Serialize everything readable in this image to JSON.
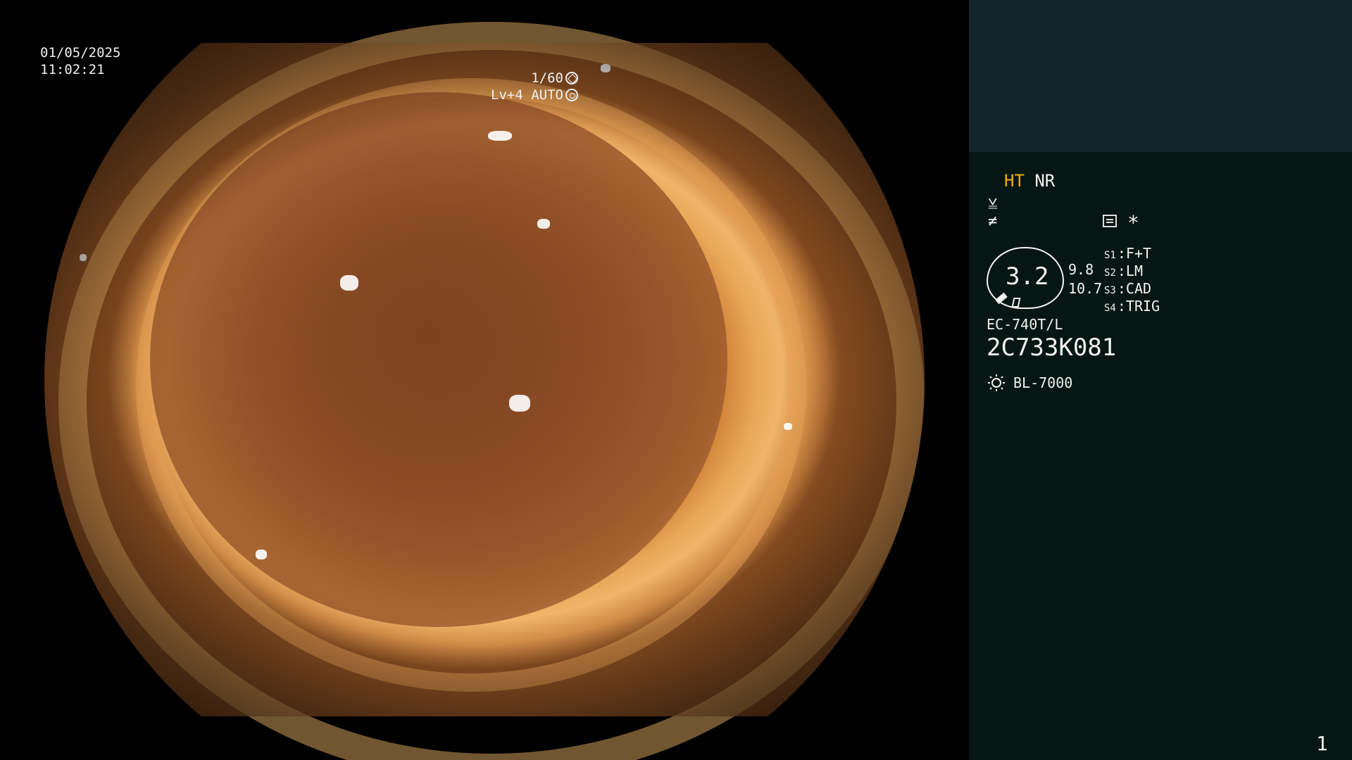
{
  "overlay": {
    "date": "01/05/2025",
    "time": "11:02:21",
    "shutter": "1/60",
    "level": "Lv+4 AUTO"
  },
  "icons": {
    "shutter": "shutter-icon",
    "auto": "auto-exposure-icon",
    "enhance": "enhance-icon",
    "contrast": "contrast-icon",
    "memo": "memo-icon",
    "lamp": "lamp-icon"
  },
  "panel": {
    "mode_ht": "HT",
    "mode_nr": "NR",
    "star": "*",
    "dial_value": "3.2",
    "dial_sub1": "9.8",
    "dial_sub2": "10.7",
    "slots": [
      {
        "key": "S1",
        "value": "F+T"
      },
      {
        "key": "S2",
        "value": "LM"
      },
      {
        "key": "S3",
        "value": "CAD"
      },
      {
        "key": "S4",
        "value": "TRIG"
      }
    ],
    "scope_model": "EC-740T/L",
    "serial": "2C733K081",
    "lamp": "BL-7000",
    "page": "1"
  },
  "colors": {
    "panel_bg": "#061613",
    "panel_top": "#12252a",
    "ht_accent": "#f0b000"
  }
}
